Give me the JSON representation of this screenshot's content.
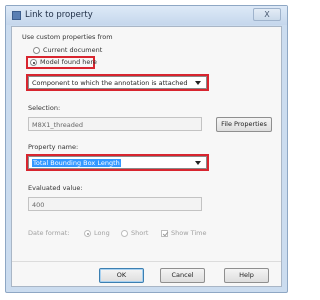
{
  "window": {
    "title": "Link to property",
    "close_glyph": "X"
  },
  "group": {
    "heading": "Use custom properties from"
  },
  "source": {
    "options": [
      "Current document",
      "Model found here"
    ],
    "selected": "Model found here"
  },
  "component_combo": {
    "value": "Component to which the annotation is attached"
  },
  "selection": {
    "label": "Selection:",
    "value": "M8X1_threaded",
    "file_properties_label": "File Properties"
  },
  "property_name": {
    "label": "Property name:",
    "value": "Total Bounding Box Length"
  },
  "evaluated": {
    "label": "Evaluated value:",
    "value": "400"
  },
  "date_format": {
    "label": "Date format:",
    "options": [
      "Long",
      "Short"
    ],
    "selected": "Long",
    "show_time_label": "Show Time",
    "show_time_checked": true
  },
  "buttons": {
    "ok": "OK",
    "cancel": "Cancel",
    "help": "Help"
  },
  "colors": {
    "highlight": "#d8252f",
    "title_bar": "#cbdcef",
    "selection_bg": "#3399ff"
  },
  "icons": [
    "app-icon",
    "close-icon",
    "chevron-down-icon"
  ]
}
